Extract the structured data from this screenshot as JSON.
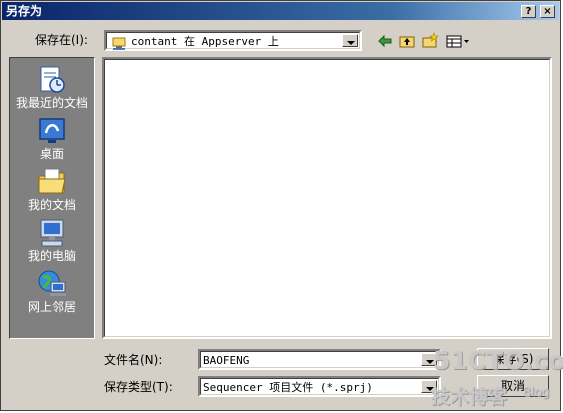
{
  "window": {
    "title": "另存为",
    "help_glyph": "?",
    "close_glyph": "×"
  },
  "savein": {
    "label": "保存在(I):",
    "value": "contant 在 Appserver 上"
  },
  "places": [
    {
      "label": "我最近的文档",
      "icon": "recent-documents-icon"
    },
    {
      "label": "桌面",
      "icon": "desktop-icon"
    },
    {
      "label": "我的文档",
      "icon": "my-documents-icon"
    },
    {
      "label": "我的电脑",
      "icon": "my-computer-icon"
    },
    {
      "label": "网上邻居",
      "icon": "network-places-icon"
    }
  ],
  "filename": {
    "label": "文件名(N):",
    "value": "BAOFENG"
  },
  "filetype": {
    "label": "保存类型(T):",
    "value": "Sequencer 项目文件 (*.sprj)"
  },
  "buttons": {
    "save": "保存(S)",
    "cancel": "取消"
  },
  "watermark": {
    "site": "51CTO.com",
    "tagline": "技术博客",
    "blog": "Blog"
  },
  "colors": {
    "titlebar": "#0a246a",
    "face": "#d4d0c8",
    "places_bg": "#808080"
  }
}
